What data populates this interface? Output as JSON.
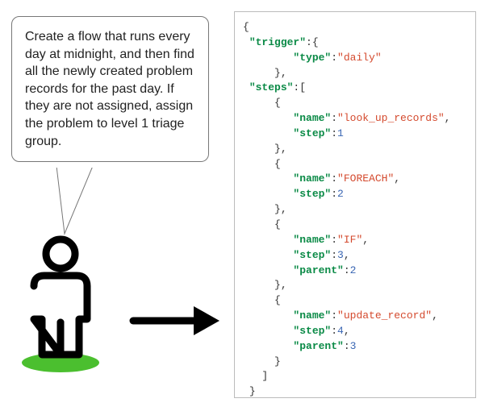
{
  "speech": {
    "text": "Create a flow that runs every day at midnight, and then find all the newly created problem records for the past day. If they are not assigned, assign the problem to level 1 triage group."
  },
  "code": {
    "trigger_key": "\"trigger\"",
    "trigger_type_key": "\"type\"",
    "trigger_type_val": "\"daily\"",
    "steps_key": "\"steps\"",
    "name_key": "\"name\"",
    "step_key": "\"step\"",
    "parent_key": "\"parent\"",
    "steps": [
      {
        "name": "\"look_up_records\"",
        "step": "1"
      },
      {
        "name": "\"FOREACH\"",
        "step": "2"
      },
      {
        "name": "\"IF\"",
        "step": "3",
        "parent": "2"
      },
      {
        "name": "\"update_record\"",
        "step": "4",
        "parent": "3"
      }
    ]
  },
  "icons": {
    "person": "person-icon",
    "arrow": "arrow-right-icon"
  }
}
